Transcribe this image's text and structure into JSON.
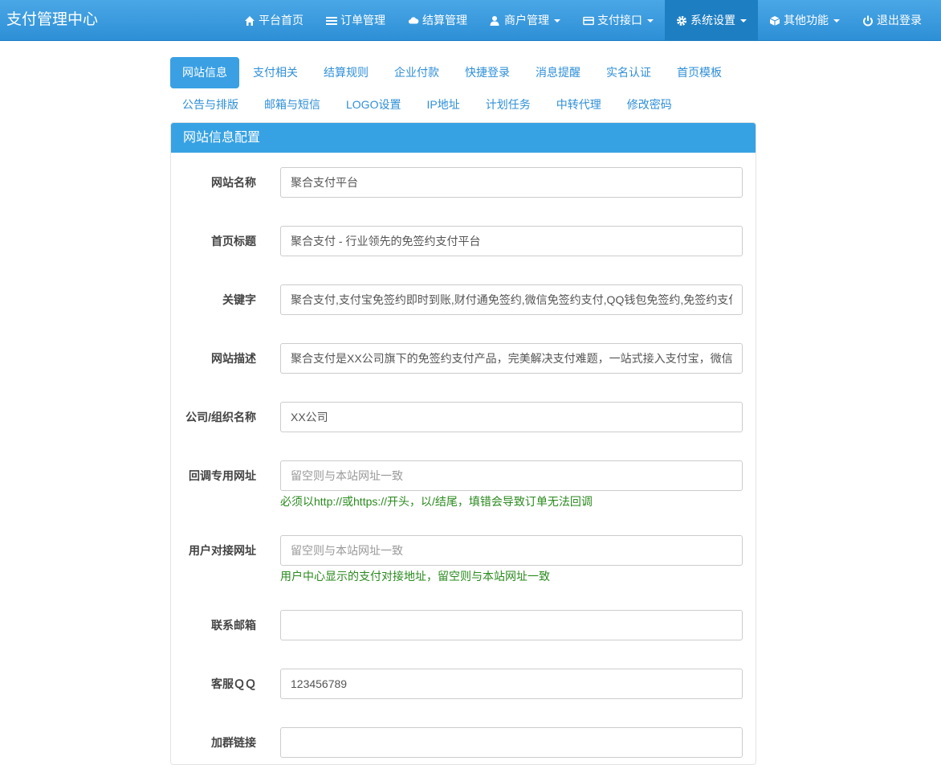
{
  "brand": "支付管理中心",
  "nav": [
    {
      "label": "平台首页",
      "icon": "home-icon",
      "active": false,
      "dropdown": false
    },
    {
      "label": "订单管理",
      "icon": "list-icon",
      "active": false,
      "dropdown": false
    },
    {
      "label": "结算管理",
      "icon": "cloud-icon",
      "active": false,
      "dropdown": false
    },
    {
      "label": "商户管理",
      "icon": "user-icon",
      "active": false,
      "dropdown": true
    },
    {
      "label": "支付接口",
      "icon": "credit-card-icon",
      "active": false,
      "dropdown": true
    },
    {
      "label": "系统设置",
      "icon": "gear-icon",
      "active": true,
      "dropdown": true
    },
    {
      "label": "其他功能",
      "icon": "cube-icon",
      "active": false,
      "dropdown": true
    },
    {
      "label": "退出登录",
      "icon": "power-icon",
      "active": false,
      "dropdown": false
    }
  ],
  "tabs": [
    {
      "label": "网站信息",
      "active": true
    },
    {
      "label": "支付相关"
    },
    {
      "label": "结算规则"
    },
    {
      "label": "企业付款"
    },
    {
      "label": "快捷登录"
    },
    {
      "label": "消息提醒"
    },
    {
      "label": "实名认证"
    },
    {
      "label": "首页模板"
    },
    {
      "label": "公告与排版"
    },
    {
      "label": "邮箱与短信"
    },
    {
      "label": "LOGO设置"
    },
    {
      "label": "IP地址"
    },
    {
      "label": "计划任务"
    },
    {
      "label": "中转代理"
    },
    {
      "label": "修改密码"
    }
  ],
  "panel": {
    "title": "网站信息配置",
    "fields": [
      {
        "label": "网站名称",
        "value": "聚合支付平台",
        "placeholder": ""
      },
      {
        "label": "首页标题",
        "value": "聚合支付 - 行业领先的免签约支付平台",
        "placeholder": ""
      },
      {
        "label": "关键字",
        "value": "聚合支付,支付宝免签约即时到账,财付通免签约,微信免签约支付,QQ钱包免签约,免签约支付",
        "placeholder": ""
      },
      {
        "label": "网站描述",
        "value": "聚合支付是XX公司旗下的免签约支付产品，完美解决支付难题，一站式接入支付宝，微信，财付通，QQ钱包,微信wap，帮助开发者快速集成到自己相应产品，效率高，见效快，费率低！",
        "placeholder": ""
      },
      {
        "label": "公司/组织名称",
        "value": "XX公司",
        "placeholder": ""
      },
      {
        "label": "回调专用网址",
        "value": "",
        "placeholder": "留空则与本站网址一致",
        "help": "必须以http://或https://开头，以/结尾，填错会导致订单无法回调"
      },
      {
        "label": "用户对接网址",
        "value": "",
        "placeholder": "留空则与本站网址一致",
        "help": "用户中心显示的支付对接地址，留空则与本站网址一致"
      },
      {
        "label": "联系邮箱",
        "value": "",
        "placeholder": ""
      },
      {
        "label": "客服ＱＱ",
        "value": "123456789",
        "placeholder": ""
      },
      {
        "label": "加群链接",
        "value": "",
        "placeholder": ""
      }
    ]
  },
  "colors": {
    "navbar": "#3a9ce0",
    "accent": "#37a2e3",
    "help_text": "#2a8a1e"
  }
}
